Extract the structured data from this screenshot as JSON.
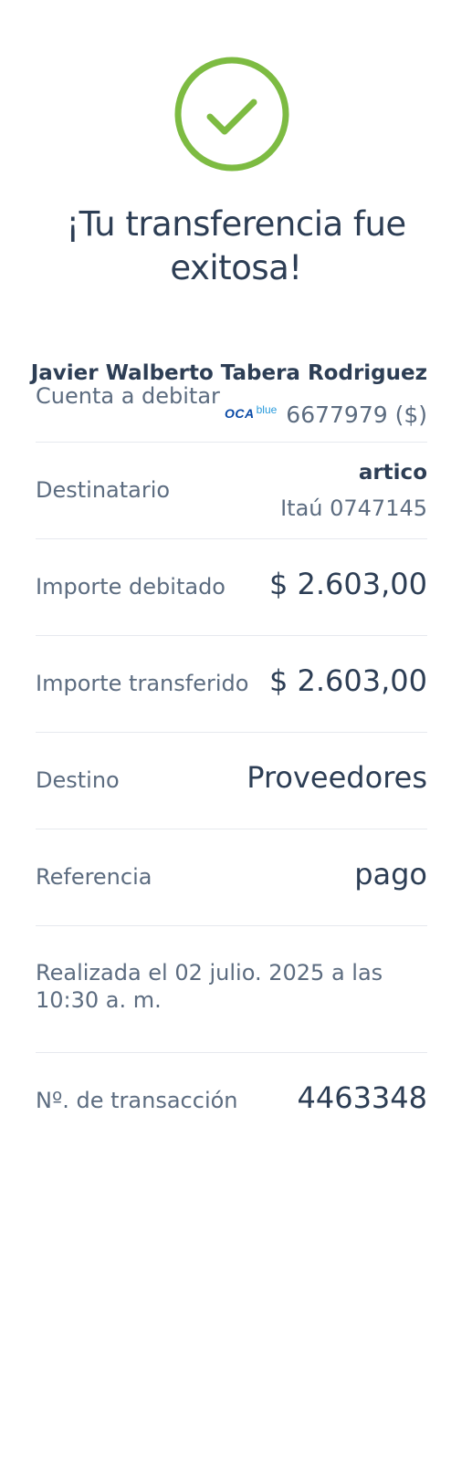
{
  "status": {
    "icon": "check-circle-icon",
    "color": "#7dbb42",
    "title": "¡Tu transferencia fue exitosa!"
  },
  "account": {
    "holder_name": "Javier Walberto Tabera Rodriguez",
    "label": "Cuenta a debitar",
    "brand_prefix": "OCA",
    "brand_suffix": "blue",
    "number": "6677979 ($)"
  },
  "recipient": {
    "label": "Destinatario",
    "name": "artico",
    "account": "Itaú 0747145"
  },
  "debited": {
    "label": "Importe debitado",
    "value": "$ 2.603,00"
  },
  "transferred": {
    "label": "Importe transferido",
    "value": "$ 2.603,00"
  },
  "destination": {
    "label": "Destino",
    "value": "Proveedores"
  },
  "reference": {
    "label": "Referencia",
    "value": "pago"
  },
  "date": {
    "text": "Realizada el 02 julio. 2025 a las 10:30 a. m."
  },
  "transaction": {
    "label": "Nº. de transacción",
    "value": "4463348"
  },
  "colors": {
    "text_primary": "#2d3e55",
    "text_secondary": "#5c6c80",
    "divider": "#e6e9ee",
    "brand_dark_blue": "#0a4aa6",
    "brand_light_blue": "#2a9bdc"
  }
}
